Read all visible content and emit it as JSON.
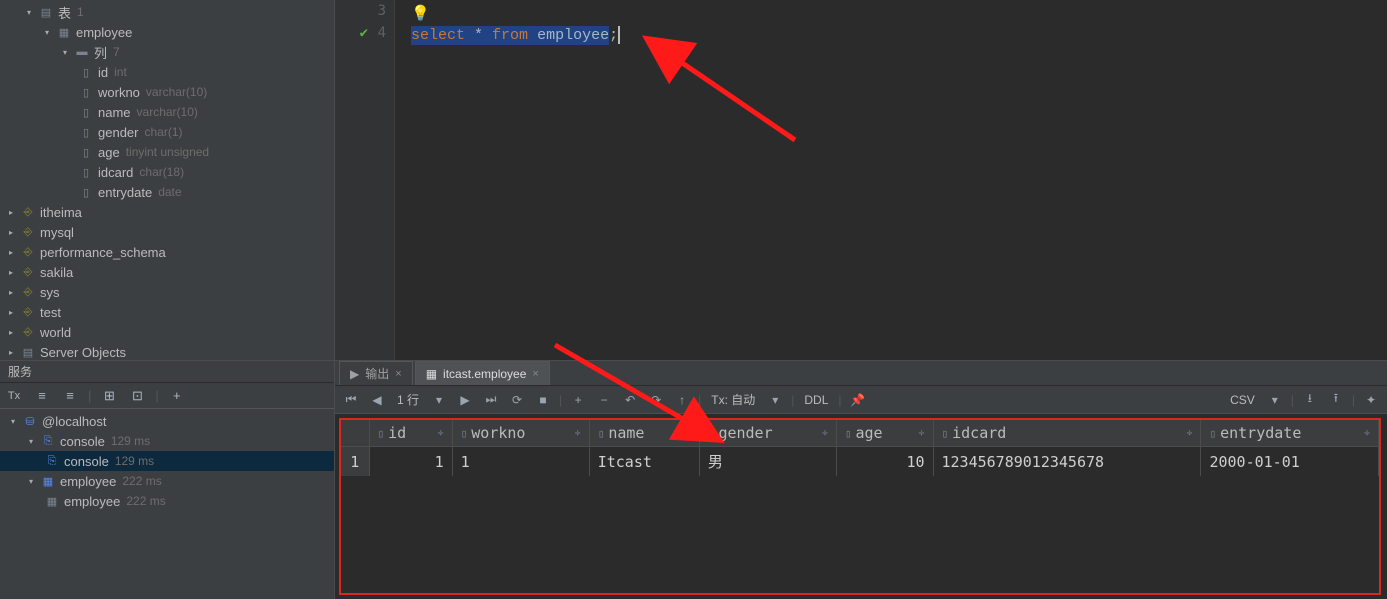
{
  "tree": {
    "tables_label": "表",
    "tables_count": "1",
    "employee_label": "employee",
    "columns_label": "列",
    "columns_count": "7",
    "columns": [
      {
        "name": "id",
        "type": "int"
      },
      {
        "name": "workno",
        "type": "varchar(10)"
      },
      {
        "name": "name",
        "type": "varchar(10)"
      },
      {
        "name": "gender",
        "type": "char(1)"
      },
      {
        "name": "age",
        "type": "tinyint unsigned"
      },
      {
        "name": "idcard",
        "type": "char(18)"
      },
      {
        "name": "entrydate",
        "type": "date"
      }
    ],
    "schemas": [
      "itheima",
      "mysql",
      "performance_schema",
      "sakila",
      "sys",
      "test",
      "world"
    ],
    "server_objects": "Server Objects"
  },
  "editor": {
    "line_numbers": {
      "l3": "3",
      "l4": "4"
    },
    "code": {
      "kw1": "select",
      "star": " * ",
      "kw2": "from",
      "sp": " ",
      "tbl": "employee",
      "semi": ";"
    }
  },
  "services": {
    "title": "服务",
    "toolbar_icons": [
      "Tx",
      "≡",
      "≡",
      "⊞",
      "⊡",
      "+"
    ],
    "root": "@localhost",
    "console_group": "console",
    "console_group_ms": "129 ms",
    "console_item": "console",
    "console_item_ms": "129 ms",
    "employee_group": "employee",
    "employee_group_ms": "222 ms",
    "employee_item": "employee",
    "employee_item_ms": "222 ms"
  },
  "result": {
    "tabs": {
      "output": "输出",
      "dataset": "itcast.employee"
    },
    "toolbar": {
      "row_info": "1 行",
      "tx_mode": "Tx: 自动",
      "ddl": "DDL",
      "csv": "CSV"
    },
    "columns": [
      "id",
      "workno",
      "name",
      "gender",
      "age",
      "idcard",
      "entrydate"
    ],
    "rownum": "1",
    "row": {
      "id": "1",
      "workno": "1",
      "name": "Itcast",
      "gender": "男",
      "age": "10",
      "idcard": "123456789012345678",
      "entrydate": "2000-01-01"
    }
  }
}
